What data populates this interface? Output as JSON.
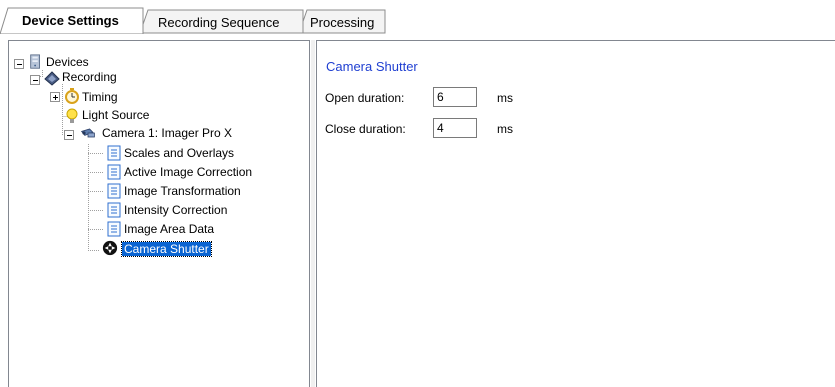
{
  "tabs": [
    {
      "label": "Device Settings",
      "active": true
    },
    {
      "label": "Recording Sequence",
      "active": false
    },
    {
      "label": "Processing",
      "active": false
    }
  ],
  "tree": {
    "devices": "Devices",
    "recording": "Recording",
    "timing": "Timing",
    "light_source": "Light Source",
    "camera": "Camera 1: Imager Pro X",
    "scales": "Scales and Overlays",
    "active_correction": "Active Image Correction",
    "transformation": "Image Transformation",
    "intensity": "Intensity Correction",
    "area_data": "Image Area Data",
    "shutter": "Camera Shutter"
  },
  "panel": {
    "title": "Camera Shutter",
    "open_label": "Open duration:",
    "open_value": "6",
    "open_unit": "ms",
    "close_label": "Close duration:",
    "close_value": "4",
    "close_unit": "ms"
  },
  "colors": {
    "accent": "#1f3fd1",
    "selection": "#0a64d2"
  },
  "icons": [
    "server-icon",
    "recording-icon",
    "stopwatch-icon",
    "lightbulb-icon",
    "camera-icon",
    "document-icon",
    "shutter-icon"
  ]
}
